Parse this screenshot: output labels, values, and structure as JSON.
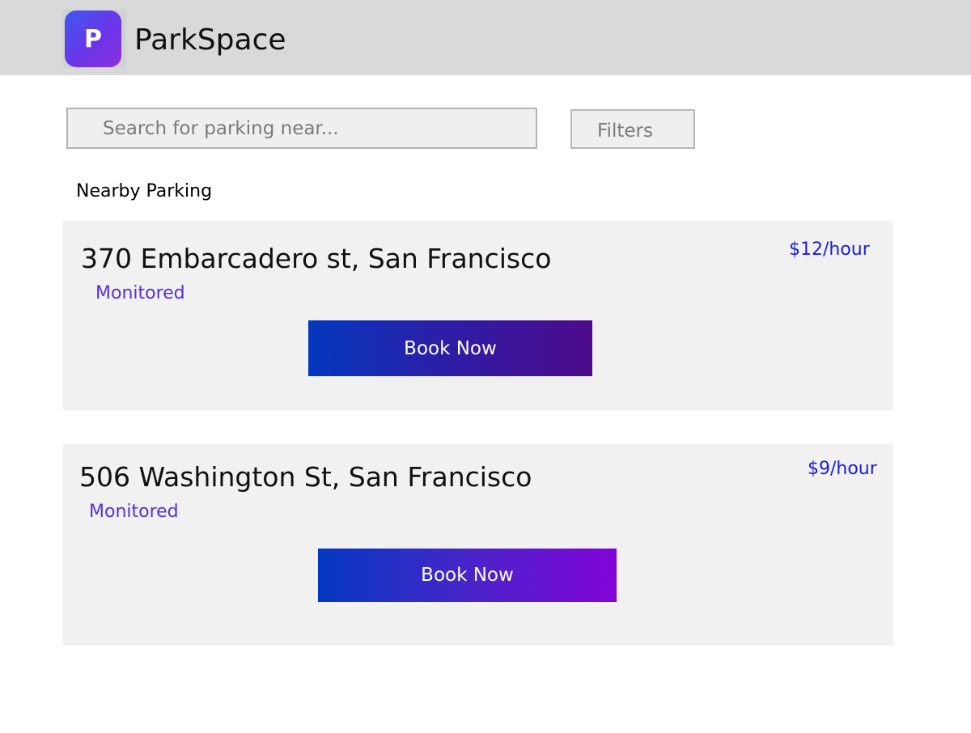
{
  "header": {
    "logo_letter": "P",
    "app_title": "ParkSpace"
  },
  "search": {
    "placeholder": "Search for parking near..."
  },
  "filters": {
    "label": "Filters"
  },
  "nearby": {
    "title": "Nearby Parking",
    "listings": [
      {
        "address": "370 Embarcadero st, San Francisco",
        "price": "$12/hour",
        "status": "Monitored",
        "book_label": "Book Now"
      },
      {
        "address": "506 Washington St, San Francisco",
        "price": "$9/hour",
        "status": "Monitored",
        "book_label": "Book Now"
      }
    ]
  },
  "colors": {
    "header_bg": "#d9d9d9",
    "card_bg": "#f1f1f2",
    "price_color": "#1c1ce0",
    "status_color": "#5a2fd6",
    "logo_gradient_start": "#3d5af1",
    "logo_gradient_end": "#8b2fe0"
  }
}
